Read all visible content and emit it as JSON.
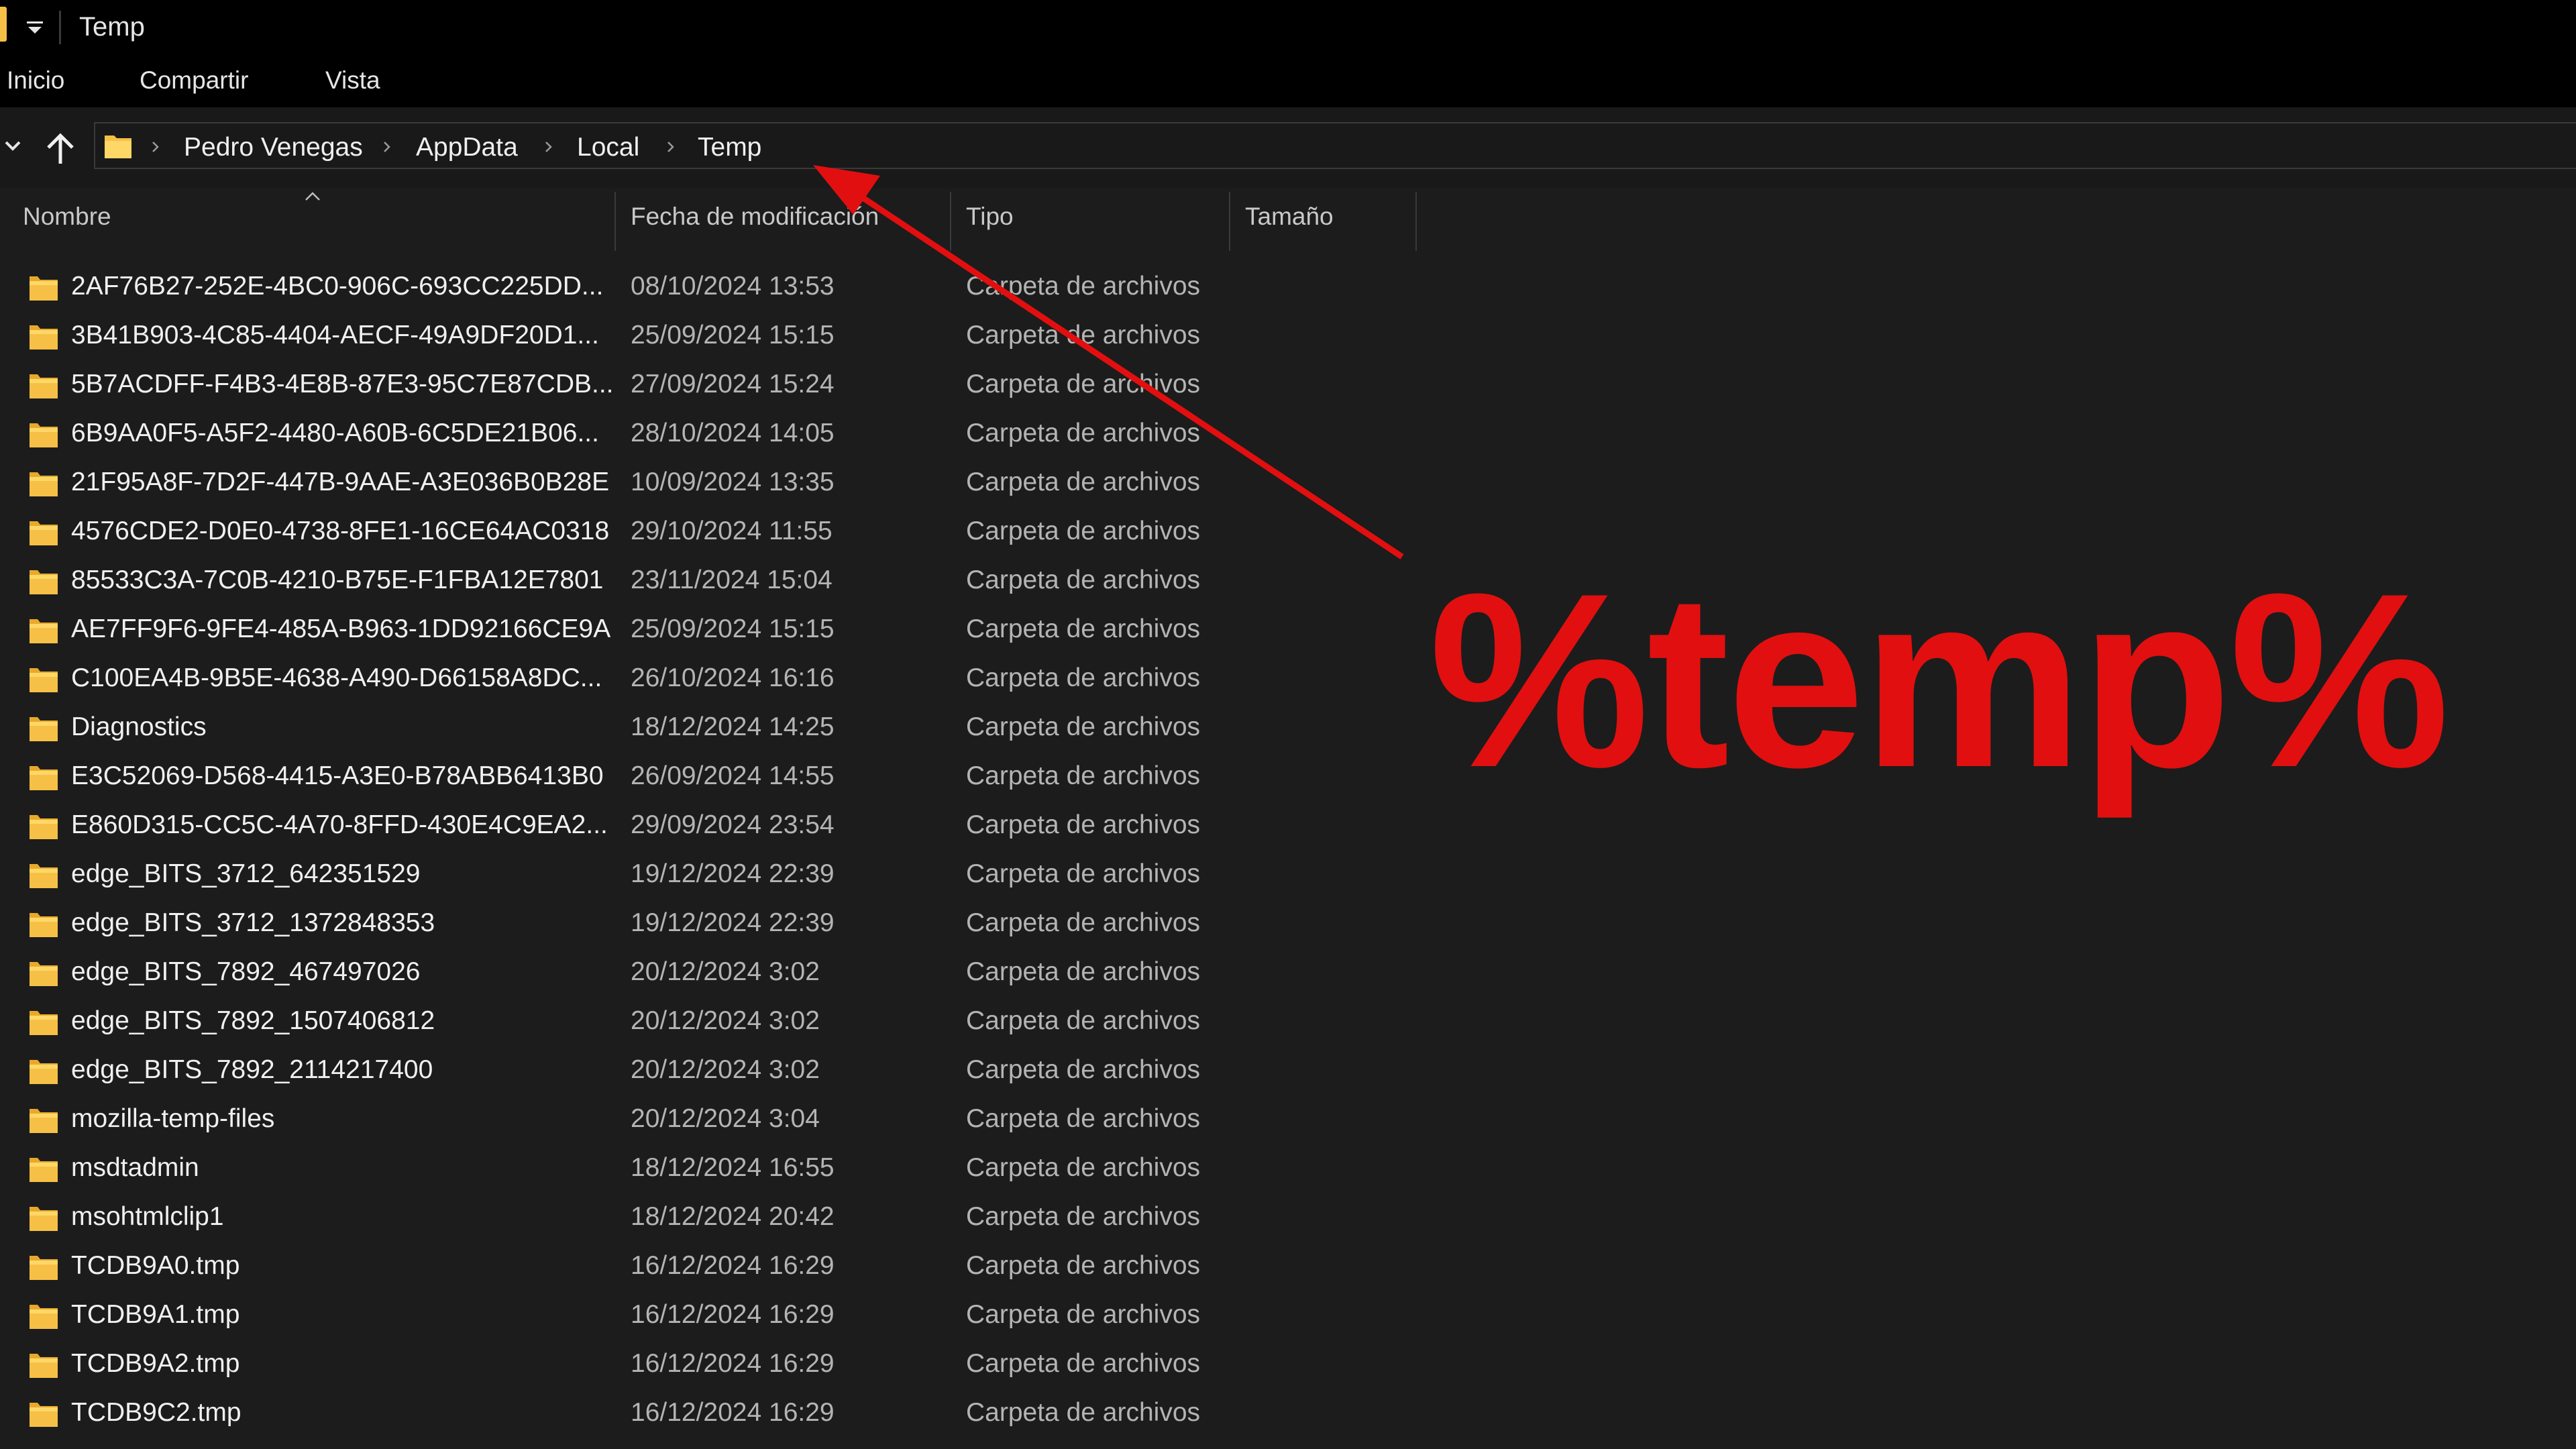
{
  "window": {
    "title": "Temp"
  },
  "ribbon": {
    "tabs": [
      "Inicio",
      "Compartir",
      "Vista"
    ]
  },
  "address": {
    "breadcrumbs": [
      "Pedro Venegas",
      "AppData",
      "Local",
      "Temp"
    ]
  },
  "columns": {
    "name": "Nombre",
    "modified": "Fecha de modificación",
    "type": "Tipo",
    "size": "Tamaño"
  },
  "files": [
    {
      "name": "2AF76B27-252E-4BC0-906C-693CC225DD...",
      "modified": "08/10/2024 13:53",
      "type": "Carpeta de archivos"
    },
    {
      "name": "3B41B903-4C85-4404-AECF-49A9DF20D1...",
      "modified": "25/09/2024 15:15",
      "type": "Carpeta de archivos"
    },
    {
      "name": "5B7ACDFF-F4B3-4E8B-87E3-95C7E87CDB...",
      "modified": "27/09/2024 15:24",
      "type": "Carpeta de archivos"
    },
    {
      "name": "6B9AA0F5-A5F2-4480-A60B-6C5DE21B06...",
      "modified": "28/10/2024 14:05",
      "type": "Carpeta de archivos"
    },
    {
      "name": "21F95A8F-7D2F-447B-9AAE-A3E036B0B28E",
      "modified": "10/09/2024 13:35",
      "type": "Carpeta de archivos"
    },
    {
      "name": "4576CDE2-D0E0-4738-8FE1-16CE64AC0318",
      "modified": "29/10/2024 11:55",
      "type": "Carpeta de archivos"
    },
    {
      "name": "85533C3A-7C0B-4210-B75E-F1FBA12E7801",
      "modified": "23/11/2024 15:04",
      "type": "Carpeta de archivos"
    },
    {
      "name": "AE7FF9F6-9FE4-485A-B963-1DD92166CE9A",
      "modified": "25/09/2024 15:15",
      "type": "Carpeta de archivos"
    },
    {
      "name": "C100EA4B-9B5E-4638-A490-D66158A8DC...",
      "modified": "26/10/2024 16:16",
      "type": "Carpeta de archivos"
    },
    {
      "name": "Diagnostics",
      "modified": "18/12/2024 14:25",
      "type": "Carpeta de archivos"
    },
    {
      "name": "E3C52069-D568-4415-A3E0-B78ABB6413B0",
      "modified": "26/09/2024 14:55",
      "type": "Carpeta de archivos"
    },
    {
      "name": "E860D315-CC5C-4A70-8FFD-430E4C9EA2...",
      "modified": "29/09/2024 23:54",
      "type": "Carpeta de archivos"
    },
    {
      "name": "edge_BITS_3712_642351529",
      "modified": "19/12/2024 22:39",
      "type": "Carpeta de archivos"
    },
    {
      "name": "edge_BITS_3712_1372848353",
      "modified": "19/12/2024 22:39",
      "type": "Carpeta de archivos"
    },
    {
      "name": "edge_BITS_7892_467497026",
      "modified": "20/12/2024 3:02",
      "type": "Carpeta de archivos"
    },
    {
      "name": "edge_BITS_7892_1507406812",
      "modified": "20/12/2024 3:02",
      "type": "Carpeta de archivos"
    },
    {
      "name": "edge_BITS_7892_2114217400",
      "modified": "20/12/2024 3:02",
      "type": "Carpeta de archivos"
    },
    {
      "name": "mozilla-temp-files",
      "modified": "20/12/2024 3:04",
      "type": "Carpeta de archivos"
    },
    {
      "name": "msdtadmin",
      "modified": "18/12/2024 16:55",
      "type": "Carpeta de archivos"
    },
    {
      "name": "msohtmlclip1",
      "modified": "18/12/2024 20:42",
      "type": "Carpeta de archivos"
    },
    {
      "name": "TCDB9A0.tmp",
      "modified": "16/12/2024 16:29",
      "type": "Carpeta de archivos"
    },
    {
      "name": "TCDB9A1.tmp",
      "modified": "16/12/2024 16:29",
      "type": "Carpeta de archivos"
    },
    {
      "name": "TCDB9A2.tmp",
      "modified": "16/12/2024 16:29",
      "type": "Carpeta de archivos"
    },
    {
      "name": "TCDB9C2.tmp",
      "modified": "16/12/2024 16:29",
      "type": "Carpeta de archivos"
    }
  ],
  "annotation": {
    "text": "%temp%",
    "color": "#e10f0f"
  },
  "colors": {
    "folder": "#f6c046",
    "background": "#1c1c1c",
    "titlebar": "#000000"
  },
  "icons": {
    "folder": "folder-icon",
    "up": "up-arrow-icon",
    "sort": "sort-ascending-icon",
    "chevron": "chevron-right-icon"
  }
}
